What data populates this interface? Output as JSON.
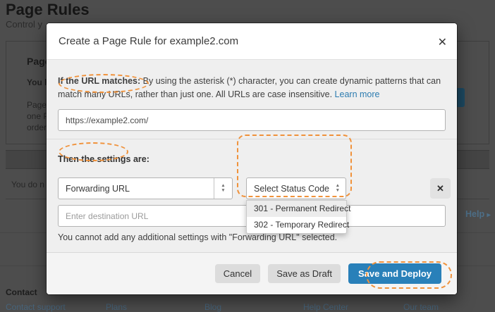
{
  "background": {
    "page_title": "Page Rules",
    "page_subtitle": "Control y",
    "panel": {
      "heading": "Page",
      "bold_fragment": "You ha",
      "line_fragments": [
        "Page R",
        "one Pa",
        "order,"
      ]
    },
    "table_row_fragment": "You do n",
    "help_label": "Help",
    "help_arrow": "▸",
    "footer_heading": "Contact",
    "footer_links": [
      "Contact support",
      "Plans",
      "Blog",
      "Help Center",
      "Our team"
    ]
  },
  "modal": {
    "title": "Create a Page Rule for example2.com",
    "url_section": {
      "lead": "If the URL matches:",
      "description": " By using the asterisk (*) character, you can create dynamic patterns that can match many URLs, rather than just one. All URLs are case insensitive. ",
      "link": "Learn more",
      "url_value": "https://example2.com/"
    },
    "settings_section": {
      "heading": "Then the settings are:",
      "setting_select_value": "Forwarding URL",
      "status_select_value": "Select Status Code",
      "status_options": [
        "301 - Permanent Redirect",
        "302 - Temporary Redirect"
      ],
      "destination_placeholder": "Enter destination URL",
      "note": "You cannot add any additional settings with \"Forwarding URL\" selected."
    },
    "footer": {
      "cancel": "Cancel",
      "save_draft": "Save as Draft",
      "save_deploy": "Save and Deploy"
    }
  },
  "icons": {
    "close": "✕",
    "remove": "✕",
    "spinner_up": "▲",
    "spinner_down": "▼"
  },
  "colors": {
    "accent_blue": "#2980b9",
    "link_blue": "#2c7cb0",
    "annotation_orange": "#f0923b"
  }
}
